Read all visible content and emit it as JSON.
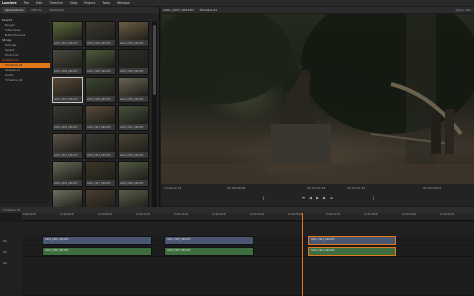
{
  "menubar": {
    "app": "Lumiere",
    "items": [
      "File",
      "Edit",
      "Timeline",
      "View",
      "Project",
      "Tools",
      "Window"
    ]
  },
  "library": {
    "tabs": [
      "Applications",
      "Effects",
      "Metadata"
    ],
    "bins": [
      {
        "label": "Events",
        "type": "hdr"
      },
      {
        "label": "Rough",
        "type": "item"
      },
      {
        "label": "Interviews",
        "type": "item"
      },
      {
        "label": "B-Roll Scenes",
        "type": "item"
      },
      {
        "label": "Stings",
        "type": "hdr"
      },
      {
        "label": "Pickups",
        "type": "item"
      },
      {
        "label": "Select",
        "type": "item"
      },
      {
        "label": "Final Cut",
        "type": "item"
      },
      {
        "label": "Untitled 01",
        "type": "red"
      },
      {
        "label": "Timeline 01",
        "type": "sel"
      },
      {
        "label": "Sequence",
        "type": "item"
      },
      {
        "label": "Audio",
        "type": "item"
      },
      {
        "label": "Timeline 02",
        "type": "item"
      }
    ],
    "thumbs": [
      "A001_C001_0612XH",
      "A001_C002_0612XH",
      "A001_C003_0612XH",
      "A001_C004_0612XH",
      "A001_C005_0612XH",
      "A001_C006_0612XH",
      "A001_C007_0612XH",
      "A001_C008_0612XH",
      "A001_C009_0612XH",
      "A001_C010_0612XH",
      "A001_C011_0612XH",
      "A001_C012_0612XH",
      "A001_C013_0612XH",
      "A001_C014_0612XH",
      "A001_C015_0612XH",
      "A001_C016_0612XH",
      "A001_C017_0612XH",
      "A001_C018_0612XH",
      "A001_C019_0612XH",
      "A001_C020_0612XH",
      "A001_C021_0612XH"
    ]
  },
  "viewer": {
    "clip_name": "A001_C007_0612XH",
    "timeline_name": "Timeline 01",
    "right_label": "Apply CDL",
    "timecode_left": "01:00:08:06",
    "timecode_center": "01:00:35:18",
    "timecode_right": "01:00:36:07",
    "duration": "00:00:01:12",
    "status": "Timeline 01"
  },
  "timeline": {
    "title": "Timeline 01",
    "ticks": [
      "01:00:00:00",
      "01:00:04:00",
      "01:00:08:00",
      "01:00:12:00",
      "01:00:16:00",
      "01:00:20:00",
      "01:00:24:00",
      "01:00:28:00",
      "01:00:32:00",
      "01:00:36:00",
      "01:00:40:00",
      "01:00:44:00"
    ],
    "tracks": [
      "V1",
      "A1",
      "A2"
    ],
    "clips": [
      {
        "label": "A001_C001_0612XH",
        "kind": "video"
      },
      {
        "label": "A001_C007_0612XH",
        "kind": "video"
      },
      {
        "label": "A001_C012_0612XH",
        "kind": "video"
      },
      {
        "label": "A001_C001_0612XH",
        "kind": "audio"
      },
      {
        "label": "A001_C007_0612XH",
        "kind": "audio"
      },
      {
        "label": "A001_C012_0612XH",
        "kind": "audio"
      }
    ]
  }
}
